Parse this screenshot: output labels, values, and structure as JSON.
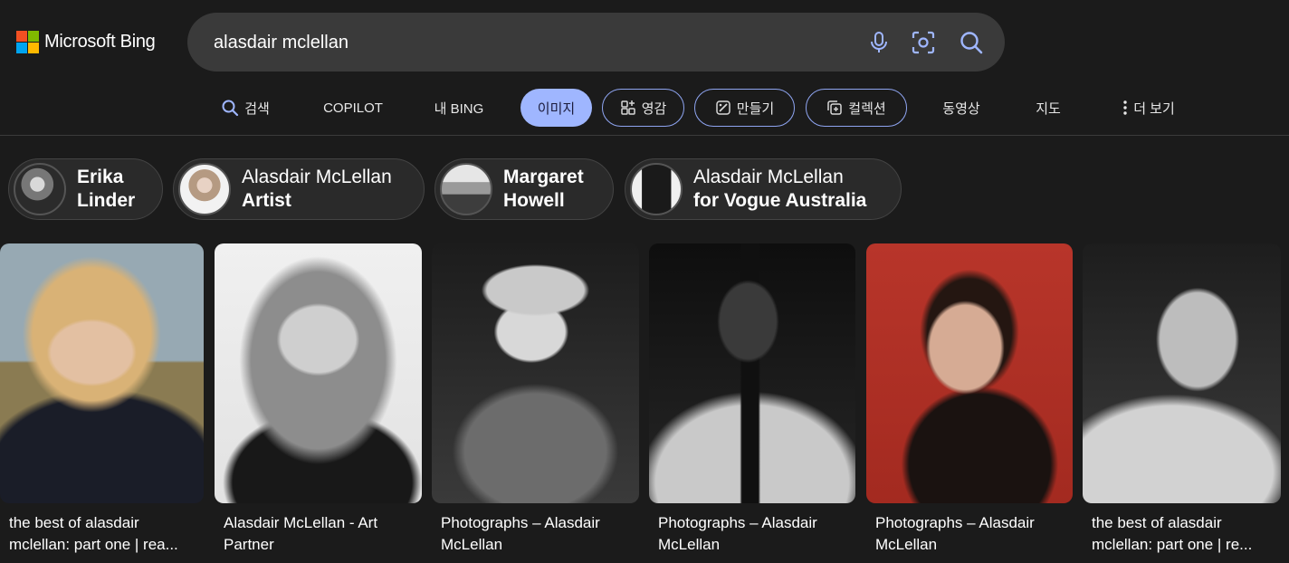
{
  "header": {
    "logo_text": "Microsoft Bing",
    "logo_colors": [
      "#f25022",
      "#7fba00",
      "#00a4ef",
      "#ffb900"
    ],
    "search_value": "alasdair mclellan",
    "icons": [
      "microphone-icon",
      "visual-search-icon",
      "search-icon"
    ]
  },
  "nav": {
    "items": [
      {
        "label": "검색",
        "icon": "search-icon"
      },
      {
        "label": "COPILOT"
      },
      {
        "label": "내 BING"
      },
      {
        "label": "이미지",
        "active": true
      },
      {
        "label": "영감",
        "icon": "inspiration-icon"
      },
      {
        "label": "만들기",
        "icon": "create-icon"
      },
      {
        "label": "컬렉션",
        "icon": "collection-icon"
      },
      {
        "label": "동영상"
      },
      {
        "label": "지도"
      },
      {
        "label": "더 보기",
        "icon": "more-vertical-icon"
      }
    ],
    "accent": "#9fb6ff"
  },
  "related": [
    {
      "line1": "Erika",
      "line2": "Linder"
    },
    {
      "line1": "Alasdair McLellan",
      "line2": "Artist"
    },
    {
      "line1": "Margaret",
      "line2": "Howell"
    },
    {
      "line1": "Alasdair McLellan",
      "line2": "for Vogue Australia"
    }
  ],
  "results": [
    {
      "caption_line1": "the best of alasdair",
      "caption_line2": "mclellan: part one | rea..."
    },
    {
      "caption_line1": "Alasdair McLellan - Art",
      "caption_line2": "Partner"
    },
    {
      "caption_line1": "Photographs – Alasdair",
      "caption_line2": "McLellan"
    },
    {
      "caption_line1": "Photographs – Alasdair",
      "caption_line2": "McLellan"
    },
    {
      "caption_line1": "Photographs – Alasdair",
      "caption_line2": "McLellan"
    },
    {
      "caption_line1": "the best of alasdair",
      "caption_line2": "mclellan: part one | re..."
    }
  ]
}
